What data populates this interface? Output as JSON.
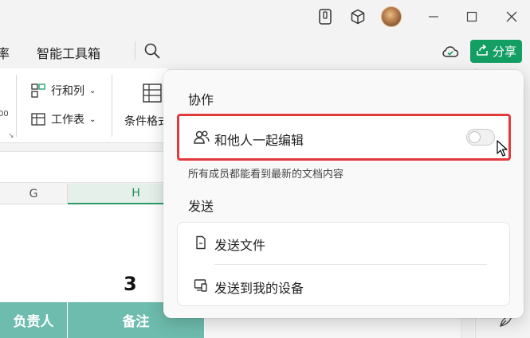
{
  "menu": {
    "partial_item": "率",
    "smart_tools": "智能工具箱"
  },
  "share": {
    "label": "分享"
  },
  "ribbon": {
    "rows_cols": "行和列",
    "worksheet": "工作表",
    "conditional_format_partial": "条件格式",
    "partial_number": "00"
  },
  "sheet": {
    "col_g": "G",
    "col_h": "H",
    "cell_value": "3",
    "header_owner_partial": "负责人",
    "header_notes": "备注"
  },
  "popup": {
    "collab_title": "协作",
    "collab_toggle_label": "和他人一起编辑",
    "collab_enabled": false,
    "collab_hint": "所有成员都能看到最新的文档内容",
    "send_title": "发送",
    "send_file": "发送文件",
    "send_to_device": "发送到我的设备"
  },
  "colors": {
    "accent": "#139e63",
    "highlight_border": "#e23a3a",
    "table_header": "#6dbcad"
  },
  "icons": {
    "titlebar": [
      "tablet-icon",
      "cube-icon",
      "avatar"
    ],
    "window": [
      "minimize-icon",
      "maximize-icon",
      "close-icon"
    ],
    "menu": [
      "search-icon",
      "cloud-check-icon",
      "share-icon"
    ],
    "popup": [
      "people-icon",
      "file-icon",
      "device-icon"
    ]
  }
}
